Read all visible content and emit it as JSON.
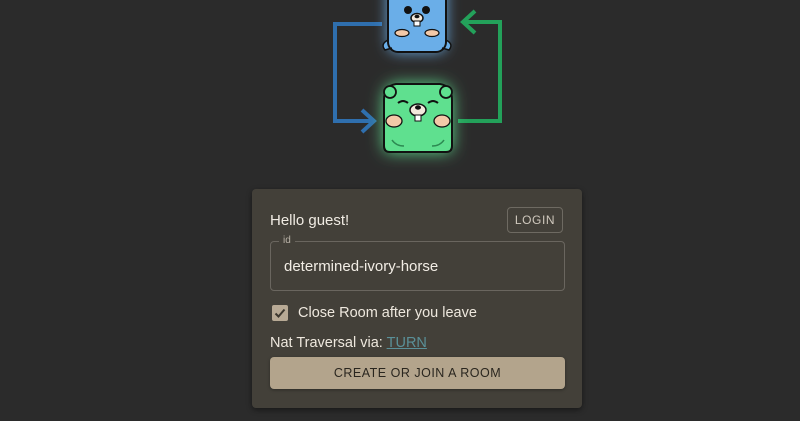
{
  "card": {
    "greeting": "Hello guest!",
    "login_label": "LOGIN",
    "id_label": "id",
    "id_value": "determined-ivory-horse",
    "close_room_label": "Close Room after you leave",
    "close_room_checked": true,
    "nat_prefix": "Nat Traversal via:",
    "nat_link": "TURN",
    "create_label": "CREATE OR JOIN A ROOM"
  },
  "colors": {
    "background": "#2b2b2b",
    "card": "#434039",
    "primary_button": "#b3a48c",
    "link": "#5a9098",
    "blue_arrow": "#2f6fae",
    "green_arrow": "#23a15a",
    "blue_gopher": "#6aaee8",
    "green_gopher": "#5fe08f"
  },
  "icons": [
    "blue-gopher-icon",
    "green-gopher-icon",
    "blue-arrow-icon",
    "green-arrow-icon",
    "check-icon"
  ]
}
